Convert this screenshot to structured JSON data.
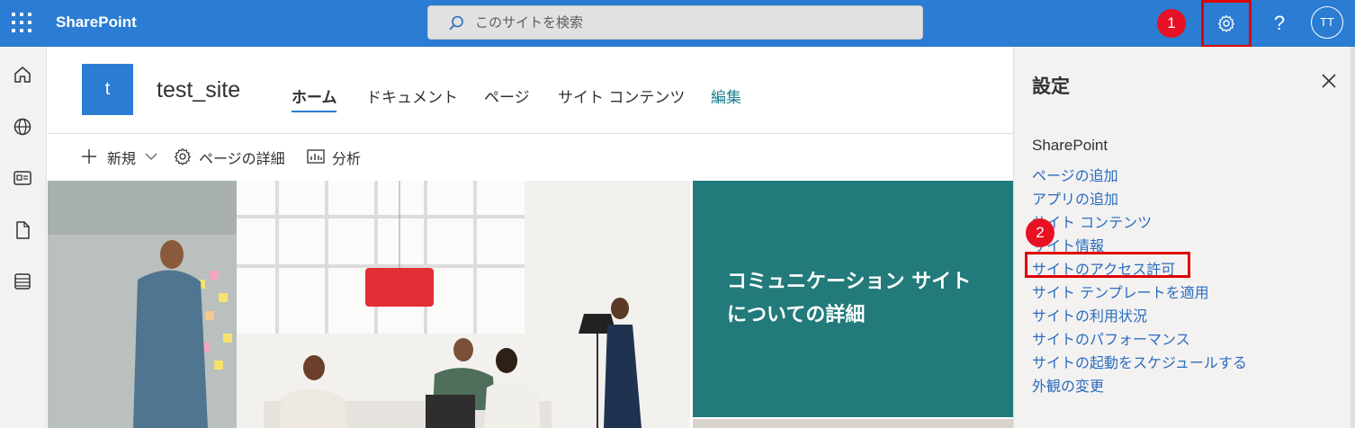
{
  "suitebar": {
    "app_name": "SharePoint",
    "search_placeholder": "このサイトを検索",
    "help_label": "?",
    "avatar_initials": "TT",
    "accent": "#2b7cd3"
  },
  "annotations": {
    "step1": "1",
    "step2": "2",
    "highlight_color": "#e00000"
  },
  "leftrail": {
    "items": [
      "home-icon",
      "globe-icon",
      "news-icon",
      "file-icon",
      "list-icon"
    ]
  },
  "site": {
    "logo_letter": "t",
    "title": "test_site",
    "nav": [
      {
        "label": "ホーム",
        "active": true
      },
      {
        "label": "ドキュメント"
      },
      {
        "label": "ページ"
      },
      {
        "label": "サイト コンテンツ"
      },
      {
        "label": "編集"
      }
    ]
  },
  "commandbar": {
    "new_label": "新規",
    "page_details_label": "ページの詳細",
    "analytics_label": "分析"
  },
  "hero": {
    "tile_text": "コミュニケーション サイトについての詳細",
    "tile_color": "#237a7a"
  },
  "settings_panel": {
    "title": "設定",
    "section": "SharePoint",
    "links": [
      "ページの追加",
      "アプリの追加",
      "サイト コンテンツ",
      "サイト情報",
      "サイトのアクセス許可",
      "サイト テンプレートを適用",
      "サイトの利用状況",
      "サイトのパフォーマンス",
      "サイトの起動をスケジュールする",
      "外観の変更"
    ],
    "link_color": "#2b6cbf"
  }
}
